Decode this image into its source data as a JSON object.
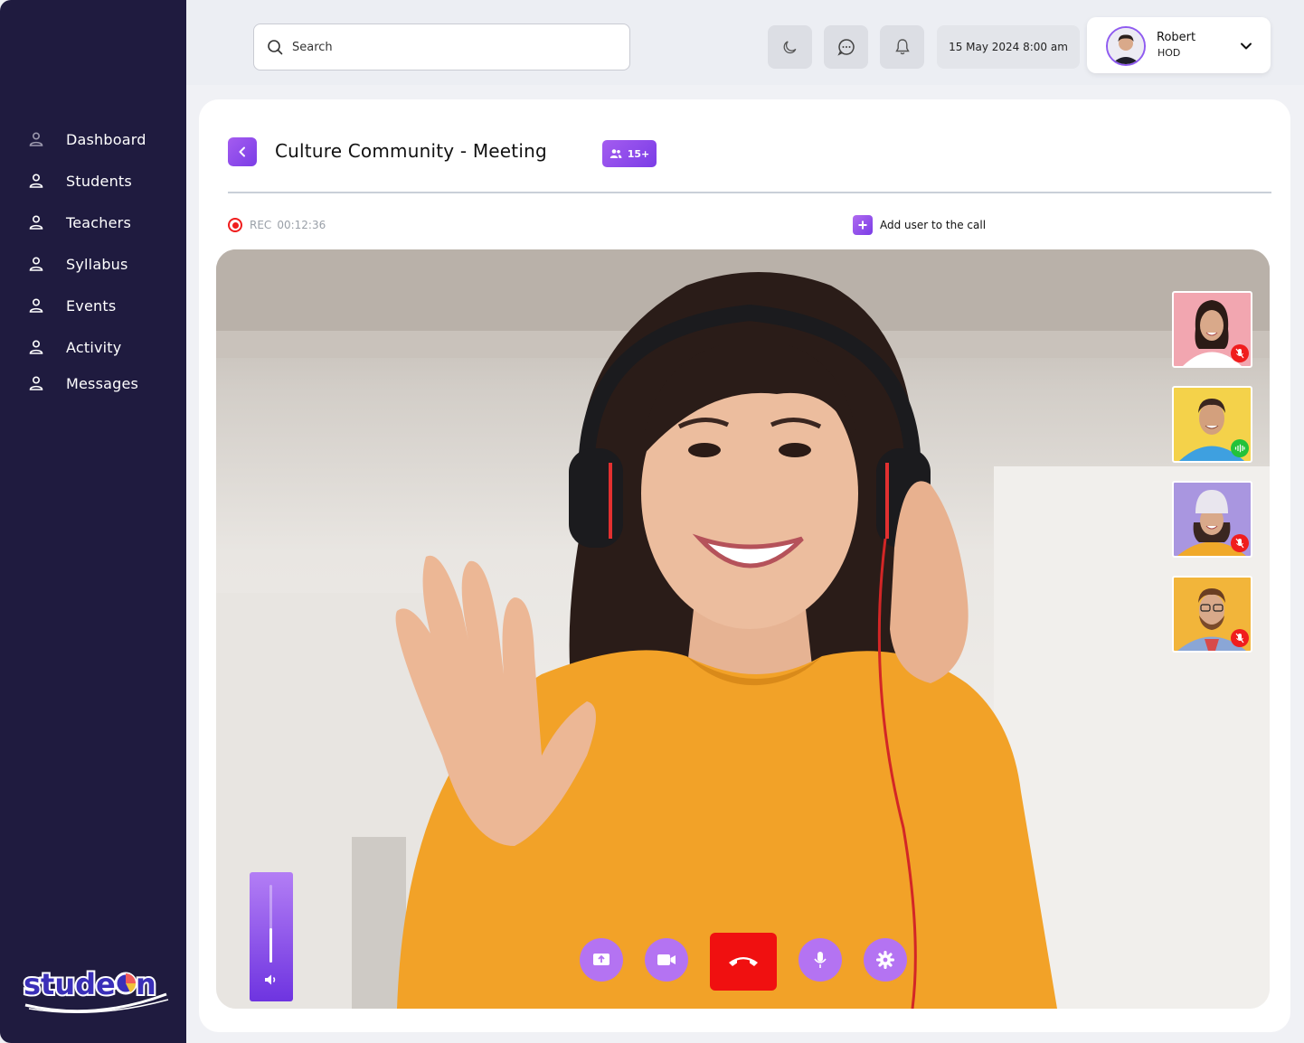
{
  "sidebar": {
    "items": [
      {
        "label": "Dashboard",
        "icon": "user-icon"
      },
      {
        "label": "Students",
        "icon": "user-icon"
      },
      {
        "label": "Teachers",
        "icon": "user-icon"
      },
      {
        "label": "Syllabus",
        "icon": "user-icon"
      },
      {
        "label": "Events",
        "icon": "user-icon"
      },
      {
        "label": "Activity",
        "icon": "user-icon"
      },
      {
        "label": "Messages",
        "icon": "user-icon"
      }
    ],
    "logo_text": "studeon"
  },
  "header": {
    "search_placeholder": "Search",
    "icons": [
      "moon-icon",
      "chat-icon",
      "bell-icon"
    ],
    "datetime": "15 May 2024 8:00 am",
    "user": {
      "name": "Robert",
      "role": "HOD"
    }
  },
  "meeting": {
    "title": "Culture Community - Meeting",
    "participants_badge": "15+",
    "rec_label": "REC",
    "rec_time": "00:12:36",
    "add_user_label": "Add user to the call",
    "participants": [
      {
        "status": "muted",
        "bg": "#f2a6b0"
      },
      {
        "status": "speaking",
        "bg": "#f4d24a"
      },
      {
        "status": "muted",
        "bg": "#a996e0"
      },
      {
        "status": "muted",
        "bg": "#f2b53a"
      }
    ],
    "volume_level": 0.44,
    "controls": [
      "share-screen-icon",
      "video-camera-icon",
      "end-call-icon",
      "microphone-icon",
      "settings-icon"
    ]
  },
  "colors": {
    "sidebar_bg": "#1f1b3f",
    "accent": "#8f4ff0",
    "end_call": "#f01010",
    "muted": "#f01d1d",
    "speaking": "#22c23a"
  }
}
